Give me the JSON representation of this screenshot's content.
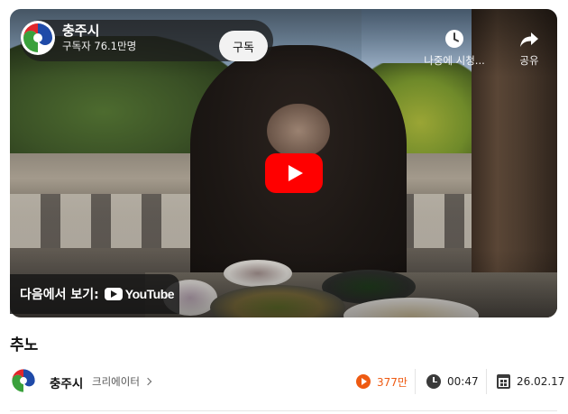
{
  "channel": {
    "name": "충주시",
    "subscribers": "구독자 76.1만명",
    "subscribe_label": "구독",
    "logo_icon": "chungju-city-logo-icon"
  },
  "player": {
    "actions": {
      "watch_later_label": "나중에 시청...",
      "share_label": "공유"
    },
    "play_icon": "play-icon",
    "watch_on_label": "다음에서 보기:",
    "watch_on_brand": "YouTube"
  },
  "video": {
    "title": "추노",
    "creator_name": "충주시",
    "creator_link_label": "크리에이터",
    "views": "377만",
    "duration": "00:47",
    "date": "26.02.17"
  },
  "colors": {
    "accent_views": "#ee5a12",
    "play_button": "#ff0000"
  }
}
